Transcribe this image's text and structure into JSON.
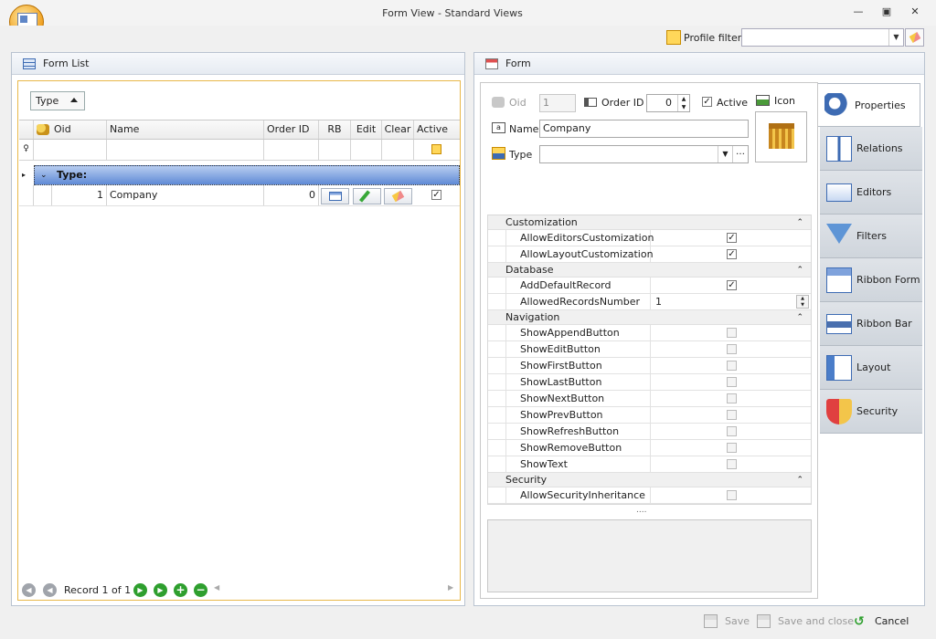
{
  "window": {
    "title": "Form View - Standard Views",
    "min": "—",
    "max": "▣",
    "close": "✕"
  },
  "profile": {
    "label": "Profile filter:",
    "value": ""
  },
  "left_panel": {
    "title": "Form List",
    "group_by": "Type",
    "columns": [
      "Oid",
      "Name",
      "Order ID",
      "RB",
      "Edit",
      "Clear",
      "Active"
    ],
    "group_row": "Type:",
    "rows": [
      {
        "oid": "1",
        "name": "Company",
        "order_id": "0",
        "active": true
      }
    ],
    "navigator": {
      "record_text": "Record 1 of 1"
    }
  },
  "right_panel": {
    "title": "Form",
    "fields": {
      "oid_label": "Oid",
      "oid_value": "1",
      "order_label": "Order ID",
      "order_value": "0",
      "active_label": "Active",
      "active_checked": true,
      "icon_label": "Icon",
      "name_label": "Name",
      "name_value": "Company",
      "type_label": "Type",
      "type_value": ""
    },
    "property_grid": {
      "categories": [
        {
          "name": "Customization",
          "rows": [
            {
              "name": "AllowEditorsCustomization",
              "type": "check",
              "checked": true
            },
            {
              "name": "AllowLayoutCustomization",
              "type": "check",
              "checked": true
            }
          ]
        },
        {
          "name": "Database",
          "rows": [
            {
              "name": "AddDefaultRecord",
              "type": "check",
              "checked": true
            },
            {
              "name": "AllowedRecordsNumber",
              "type": "spin",
              "value": "1"
            }
          ]
        },
        {
          "name": "Navigation",
          "rows": [
            {
              "name": "ShowAppendButton",
              "type": "check",
              "checked": false,
              "disabled": true
            },
            {
              "name": "ShowEditButton",
              "type": "check",
              "checked": false,
              "disabled": true
            },
            {
              "name": "ShowFirstButton",
              "type": "check",
              "checked": false,
              "disabled": true
            },
            {
              "name": "ShowLastButton",
              "type": "check",
              "checked": false,
              "disabled": true
            },
            {
              "name": "ShowNextButton",
              "type": "check",
              "checked": false,
              "disabled": true
            },
            {
              "name": "ShowPrevButton",
              "type": "check",
              "checked": false,
              "disabled": true
            },
            {
              "name": "ShowRefreshButton",
              "type": "check",
              "checked": false,
              "disabled": true
            },
            {
              "name": "ShowRemoveButton",
              "type": "check",
              "checked": false,
              "disabled": true
            },
            {
              "name": "ShowText",
              "type": "check",
              "checked": false,
              "disabled": true
            }
          ]
        },
        {
          "name": "Security",
          "rows": [
            {
              "name": "AllowSecurityInheritance",
              "type": "check",
              "checked": false,
              "disabled": true
            }
          ]
        }
      ]
    },
    "splitter": "....",
    "tabs": [
      {
        "label": "Properties",
        "icon": "properties-icon",
        "active": true
      },
      {
        "label": "Relations",
        "icon": "relations-icon"
      },
      {
        "label": "Editors",
        "icon": "editors-icon"
      },
      {
        "label": "Filters",
        "icon": "filters-icon"
      },
      {
        "label": "Ribbon Form",
        "icon": "ribbon-form-icon"
      },
      {
        "label": "Ribbon Bar",
        "icon": "ribbon-bar-icon"
      },
      {
        "label": "Layout",
        "icon": "layout-icon"
      },
      {
        "label": "Security",
        "icon": "security-icon"
      }
    ]
  },
  "bottom": {
    "save": "Save",
    "save_close": "Save and close",
    "cancel": "Cancel"
  }
}
